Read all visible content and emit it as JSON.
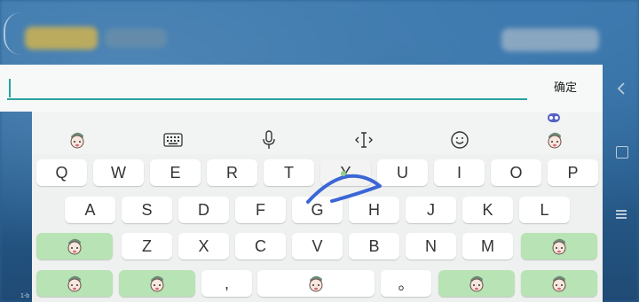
{
  "input": {
    "placeholder": "",
    "confirm_label": "确定"
  },
  "toolbar": {
    "items": [
      "sticker-icon",
      "keyboard-icon",
      "microphone-icon",
      "text-cursor-icon",
      "emoji-icon",
      "sticker-icon"
    ]
  },
  "keys": {
    "row1": [
      "Q",
      "W",
      "E",
      "R",
      "T",
      "Y",
      "U",
      "I",
      "O",
      "P"
    ],
    "row2": [
      "A",
      "S",
      "D",
      "F",
      "G",
      "H",
      "J",
      "K",
      "L"
    ],
    "row3": [
      "Z",
      "X",
      "C",
      "V",
      "B",
      "N",
      "M"
    ],
    "row4_comma": ",",
    "row4_period": "。"
  },
  "colors": {
    "accent": "#2aa39e",
    "sticker_key": "#b8e3b4",
    "swipe_stroke": "#3b66d6"
  },
  "background_tag": "1-b"
}
